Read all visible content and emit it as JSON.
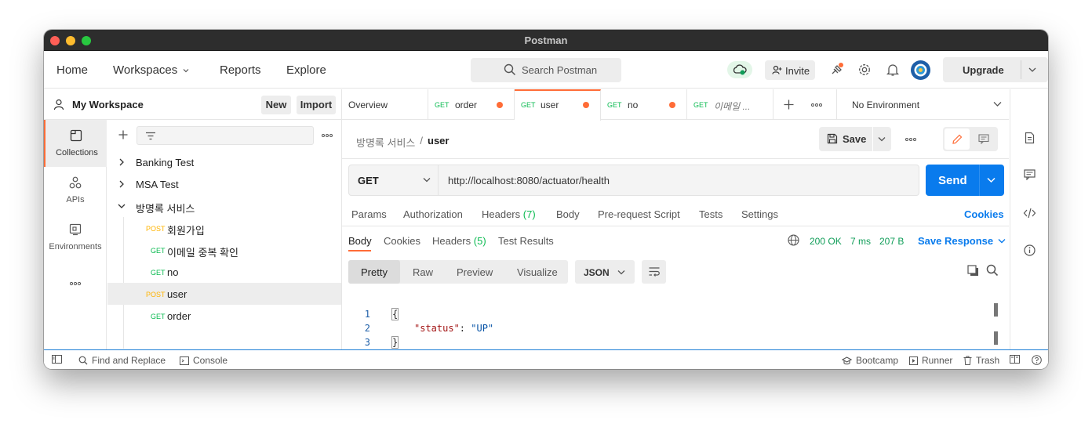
{
  "window": {
    "title": "Postman"
  },
  "header": {
    "nav": {
      "home": "Home",
      "workspaces": "Workspaces",
      "reports": "Reports",
      "explore": "Explore"
    },
    "search_placeholder": "Search Postman",
    "invite": "Invite",
    "upgrade": "Upgrade"
  },
  "workspace": {
    "name": "My Workspace",
    "new": "New",
    "import": "Import"
  },
  "rail": {
    "collections": "Collections",
    "apis": "APIs",
    "environments": "Environments"
  },
  "tree": {
    "items": [
      {
        "label": "Banking Test",
        "type": "collection",
        "expanded": false
      },
      {
        "label": "MSA Test",
        "type": "collection",
        "expanded": false
      },
      {
        "label": "방명록 서비스",
        "type": "collection",
        "expanded": true
      },
      {
        "method": "POST",
        "label": "회원가입"
      },
      {
        "method": "GET",
        "label": "이메일 중복 확인"
      },
      {
        "method": "GET",
        "label": "no"
      },
      {
        "method": "POST",
        "label": "user",
        "selected": true
      },
      {
        "method": "GET",
        "label": "order"
      }
    ]
  },
  "tabs": [
    {
      "label": "Overview"
    },
    {
      "method": "GET",
      "label": "order"
    },
    {
      "method": "GET",
      "label": "user",
      "active": true
    },
    {
      "method": "GET",
      "label": "no"
    },
    {
      "method": "GET",
      "label": "이메일 ..."
    }
  ],
  "environment": "No Environment",
  "request": {
    "breadcrumb_parent": "방명록 서비스",
    "breadcrumb_sep": "/",
    "name": "user",
    "save": "Save",
    "method": "GET",
    "url": "http://localhost:8080/actuator/health",
    "send": "Send"
  },
  "request_tabs": {
    "params": "Params",
    "authorization": "Authorization",
    "headers": "Headers",
    "headers_count": "(7)",
    "body": "Body",
    "prerequest": "Pre-request Script",
    "tests": "Tests",
    "settings": "Settings",
    "cookies": "Cookies"
  },
  "response": {
    "tabs": {
      "body": "Body",
      "cookies": "Cookies",
      "headers": "Headers",
      "headers_count": "(5)",
      "test_results": "Test Results"
    },
    "status": "200 OK",
    "time": "7 ms",
    "size": "207 B",
    "save_response": "Save Response",
    "formats": {
      "pretty": "Pretty",
      "raw": "Raw",
      "preview": "Preview",
      "visualize": "Visualize"
    },
    "language": "JSON",
    "lines": [
      {
        "n": "1",
        "text": "{"
      },
      {
        "n": "2",
        "key": "\"status\"",
        "colon": ": ",
        "value": "\"UP\""
      },
      {
        "n": "3",
        "text": "}"
      }
    ]
  },
  "statusbar": {
    "find_replace": "Find and Replace",
    "console": "Console",
    "bootcamp": "Bootcamp",
    "runner": "Runner",
    "trash": "Trash"
  },
  "colors": {
    "accent": "#ff6c37",
    "primary": "#097bed",
    "get": "#0cbb52",
    "post": "#ffb400",
    "ok": "#0f9d58"
  }
}
